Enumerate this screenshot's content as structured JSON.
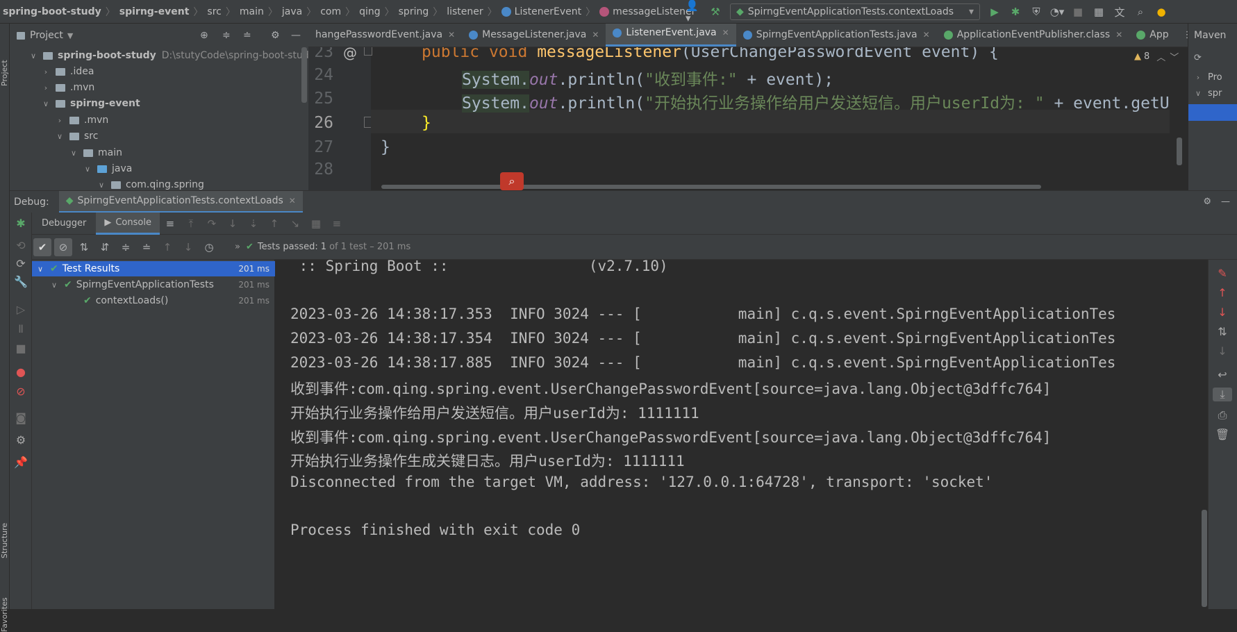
{
  "breadcrumbs": [
    "spring-boot-study",
    "spirng-event",
    "src",
    "main",
    "java",
    "com",
    "qing",
    "spring",
    "listener",
    "ListenerEvent",
    "messageListener"
  ],
  "run_config": "SpirngEventApplicationTests.contextLoads",
  "project_panel": {
    "title": "Project",
    "tree": [
      {
        "label": "spring-boot-study",
        "path": "D:\\stutyCode\\spring-boot-study"
      },
      {
        "label": ".idea"
      },
      {
        "label": ".mvn"
      },
      {
        "label": "spirng-event"
      },
      {
        "label": ".mvn"
      },
      {
        "label": "src"
      },
      {
        "label": "main"
      },
      {
        "label": "java"
      },
      {
        "label": "com.qing.spring"
      }
    ]
  },
  "editor": {
    "tabs": [
      "hangePasswordEvent.java",
      "MessageListener.java",
      "ListenerEvent.java",
      "SpirngEventApplicationTests.java",
      "ApplicationEventPublisher.class",
      "App"
    ],
    "active_tab": "ListenerEvent.java",
    "warnings": "8",
    "line_numbers": [
      "23",
      "24",
      "25",
      "26",
      "27",
      "28"
    ],
    "lines": {
      "l23_kw1": "public",
      "l23_kw2": "void",
      "l23_fn": "messageListener",
      "l23_rest": "(UserChangePasswordEvent event) {",
      "l24_a": "System.",
      "l24_out": "out",
      "l24_b": ".println(",
      "l24_str": "\"收到事件:\"",
      "l24_c": " + event);",
      "l25_a": "System.",
      "l25_out": "out",
      "l25_b": ".println(",
      "l25_str": "\"开始执行业务操作给用户发送短信。用户userId为: \"",
      "l25_c": " + event.getU",
      "l26": "}",
      "l27": "}"
    }
  },
  "maven": {
    "title": "Maven",
    "items": [
      "Pro",
      "spr"
    ]
  },
  "debug": {
    "label": "Debug:",
    "session_tab": "SpirngEventApplicationTests.contextLoads",
    "tabs": [
      "Debugger",
      "Console"
    ],
    "tests_passed": "Tests passed:",
    "tests_count": "1",
    "tests_detail": "of 1 test – 201 ms",
    "test_tree": [
      {
        "label": "Test Results",
        "time": "201 ms"
      },
      {
        "label": "SpirngEventApplicationTests",
        "time": "201 ms"
      },
      {
        "label": "contextLoads()",
        "time": "201 ms"
      }
    ],
    "console": [
      " :: Spring Boot ::                (v2.7.10)",
      "",
      "2023-03-26 14:38:17.353  INFO 3024 --- [           main] c.q.s.event.SpirngEventApplicationTes",
      "2023-03-26 14:38:17.354  INFO 3024 --- [           main] c.q.s.event.SpirngEventApplicationTes",
      "2023-03-26 14:38:17.885  INFO 3024 --- [           main] c.q.s.event.SpirngEventApplicationTes",
      "收到事件:com.qing.spring.event.UserChangePasswordEvent[source=java.lang.Object@3dffc764]",
      "开始执行业务操作给用户发送短信。用户userId为: 1111111",
      "收到事件:com.qing.spring.event.UserChangePasswordEvent[source=java.lang.Object@3dffc764]",
      "开始执行业务操作生成关键日志。用户userId为: 1111111",
      "Disconnected from the target VM, address: '127.0.0.1:64728', transport: 'socket'",
      "",
      "Process finished with exit code 0"
    ]
  },
  "side_labels": {
    "project": "Project",
    "structure": "Structure",
    "favorites": "Favorites"
  },
  "colors": {
    "accent": "#4a88c7",
    "pass": "#59a869",
    "keyword": "#cc7832",
    "function": "#ffc66d",
    "string": "#6a8759"
  }
}
